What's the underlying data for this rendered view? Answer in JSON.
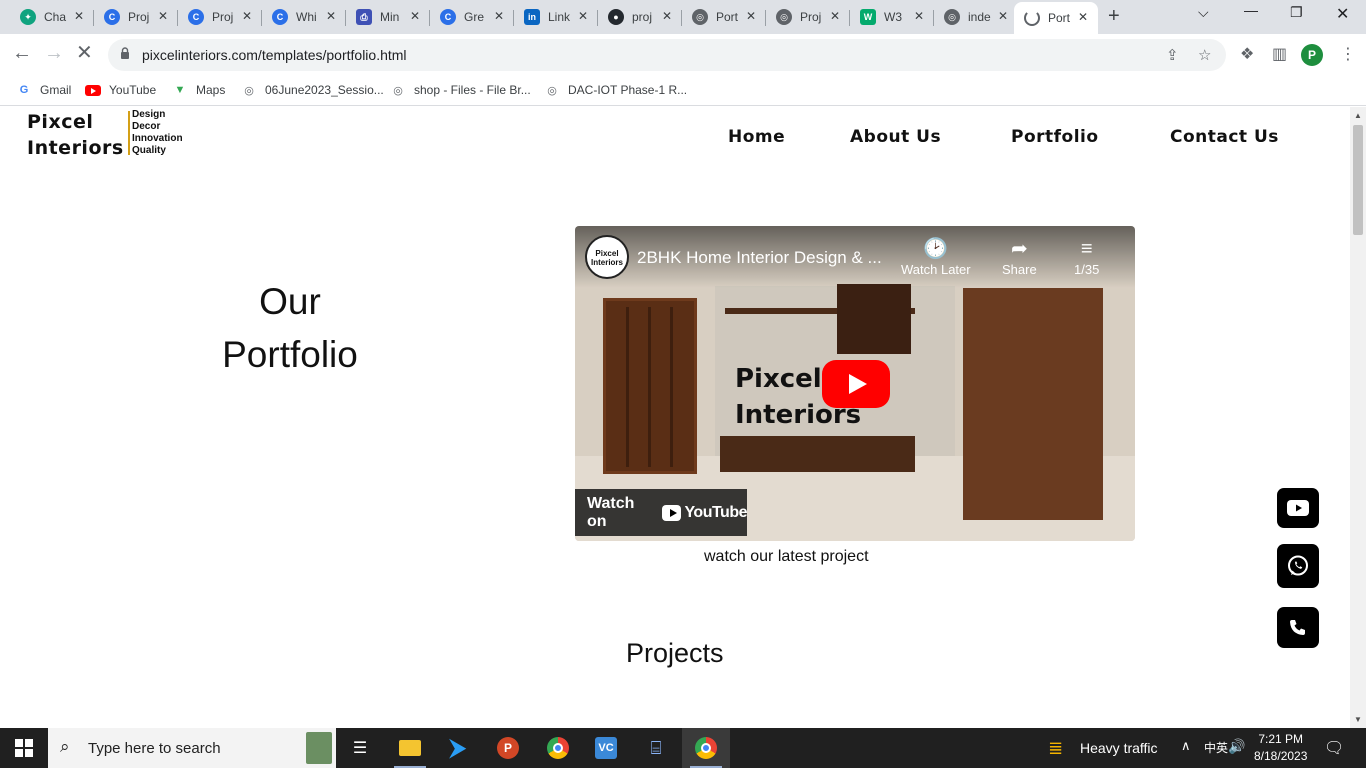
{
  "browser": {
    "tabs": [
      {
        "title": "Cha",
        "icon": "chatgpt-icon",
        "color": "#10a37f"
      },
      {
        "title": "Proj",
        "icon": "canva-icon",
        "color": "#2b6fe8"
      },
      {
        "title": "Proj",
        "icon": "canva-icon",
        "color": "#2b6fe8"
      },
      {
        "title": "Whi",
        "icon": "canva-icon",
        "color": "#2b6fe8"
      },
      {
        "title": "Min",
        "icon": "printer-icon",
        "color": "#3f51b5"
      },
      {
        "title": "Gre",
        "icon": "canva-icon",
        "color": "#2b6fe8"
      },
      {
        "title": "Link",
        "icon": "linkedin-icon",
        "color": "#0a66c2"
      },
      {
        "title": "proj",
        "icon": "github-icon",
        "color": "#24292f"
      },
      {
        "title": "Port",
        "icon": "globe-icon",
        "color": "#5f6368"
      },
      {
        "title": "Proj",
        "icon": "globe-icon",
        "color": "#5f6368"
      },
      {
        "title": "W3",
        "icon": "w3schools-icon",
        "color": "#04aa6d"
      },
      {
        "title": "inde",
        "icon": "globe-icon",
        "color": "#5f6368"
      },
      {
        "title": "Port",
        "icon": "loading-icon",
        "color": "#5f6368"
      }
    ],
    "url": "pixcelinteriors.com/templates/portfolio.html",
    "profile_initial": "P",
    "bookmarks": [
      {
        "label": "Gmail",
        "icon": "google-icon"
      },
      {
        "label": "YouTube",
        "icon": "youtube-icon"
      },
      {
        "label": "Maps",
        "icon": "maps-icon"
      },
      {
        "label": "06June2023_Sessio...",
        "icon": "globe-icon"
      },
      {
        "label": "shop - Files - File Br...",
        "icon": "globe-icon"
      },
      {
        "label": "DAC-IOT Phase-1 R...",
        "icon": "globe-icon"
      }
    ]
  },
  "site": {
    "logo": {
      "line1": "Pixcel",
      "line2": "Interiors",
      "tagline": [
        "Design",
        "Decor",
        "Innovation",
        "Quality"
      ],
      "accent": "#d4a017"
    },
    "nav": [
      "Home",
      "About Us",
      "Portfolio",
      "Contact Us"
    ],
    "hero": {
      "line1": "Our",
      "line2": "Portfolio"
    },
    "video": {
      "channel_logo": "Pixcel Interiors",
      "title": "2BHK Home Interior Design & ...",
      "watch_later": "Watch Later",
      "share": "Share",
      "playlist": "1/35",
      "watch_on": "Watch on",
      "youtube_word": "YouTube",
      "thumb_logo_line1": "Pixcel",
      "thumb_logo_line2": "Interiors"
    },
    "video_caption": "watch our latest project",
    "projects_heading": "Projects"
  },
  "taskbar": {
    "search_placeholder": "Type here to search",
    "weather": "Heavy traffic",
    "time": "7:21 PM",
    "date": "8/18/2023",
    "tray_ime": "中英"
  }
}
